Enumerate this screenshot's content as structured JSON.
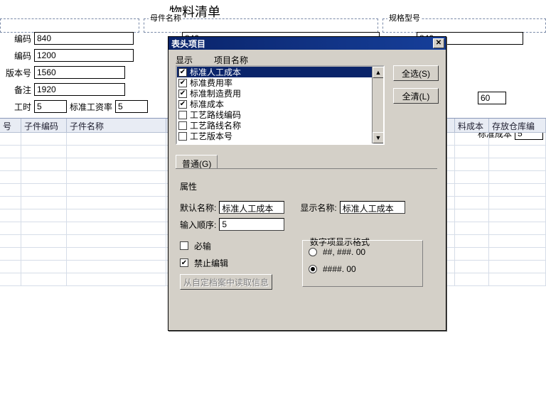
{
  "title_main": "物料清单",
  "bg": {
    "fieldsets": [
      "",
      "母件名称",
      "规格型号"
    ],
    "rows": [
      {
        "label": "编码",
        "value": "840"
      },
      {
        "label": "编码",
        "value": "1200"
      },
      {
        "label": "版本号",
        "value": "1560"
      },
      {
        "label": "备注",
        "value": "1920"
      }
    ],
    "row2_val": "840",
    "row2_right": "840",
    "row3_right": "60",
    "hours_label": "工时",
    "hours": "5",
    "rate_label": "标准工资率",
    "rate": "5",
    "cost_label": "标准成本",
    "cost": "5",
    "table_headers": [
      "号",
      "子件编码",
      "子件名称",
      "",
      "",
      "",
      "料成本",
      "存放仓库编"
    ]
  },
  "dlg": {
    "title": "表头项目",
    "col_show": "显示",
    "col_name": "项目名称",
    "items": [
      {
        "checked": true,
        "label": "标准人工成本",
        "selected": true
      },
      {
        "checked": true,
        "label": "标准费用率"
      },
      {
        "checked": true,
        "label": "标准制造费用"
      },
      {
        "checked": true,
        "label": "标准成本"
      },
      {
        "checked": false,
        "label": "工艺路线编码"
      },
      {
        "checked": false,
        "label": "工艺路线名称"
      },
      {
        "checked": false,
        "label": "工艺版本号"
      }
    ],
    "btn_all": "全选(S)",
    "btn_clear": "全清(L)",
    "tab": "普通(G)",
    "group": "属性",
    "default_name_lbl": "默认名称:",
    "default_name": "标准人工成本",
    "display_name_lbl": "显示名称:",
    "display_name": "标准人工成本",
    "order_lbl": "输入顺序:",
    "order": "5",
    "required": "必输",
    "lock_edit": "禁止编辑",
    "read_btn": "从自定档案中读取信息",
    "numfmt_title": "数字项显示格式",
    "fmt1": "##, ###. 00",
    "fmt2": "####. 00",
    "selected_fmt": 2
  }
}
